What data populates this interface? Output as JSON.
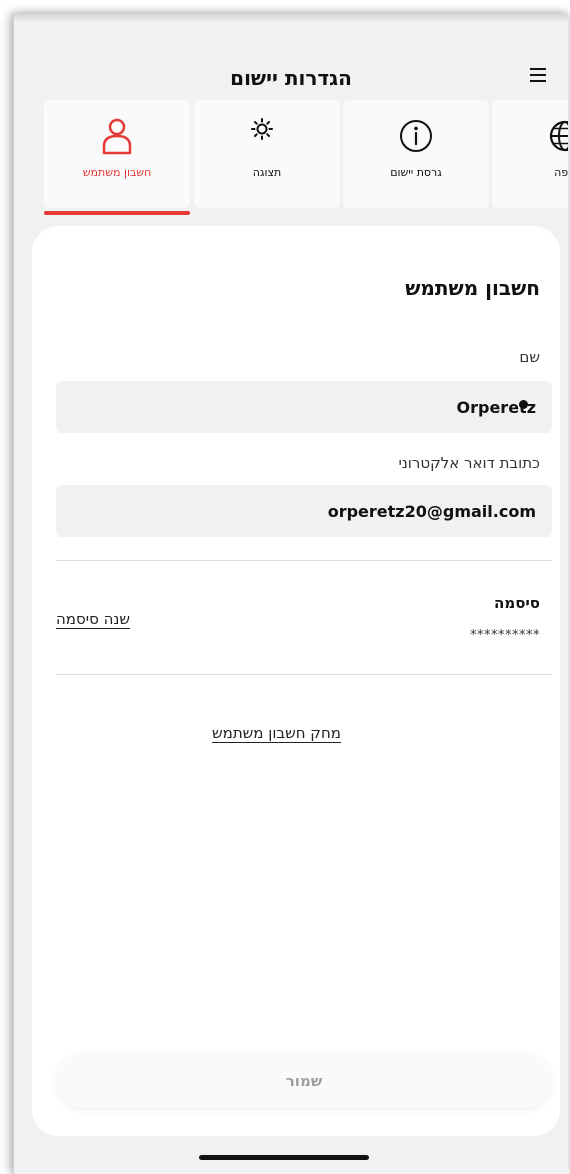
{
  "header": {
    "title": "הגדרות יישום"
  },
  "tabs": [
    {
      "label": "חשבון משתמש",
      "icon": "user-icon",
      "active": true
    },
    {
      "label": "תצוגה",
      "icon": "sun-moon-icon",
      "active": false
    },
    {
      "label": "גרסת יישום",
      "icon": "info-icon",
      "active": false
    },
    {
      "label": "שפה",
      "icon": "globe-icon",
      "active": false
    }
  ],
  "account": {
    "title": "חשבון משתמש",
    "name_label": "שם",
    "name_value": "Orperetz",
    "email_label": "כתובת דואר אלקטרוני",
    "email_value": "orperetz20@gmail.com",
    "password_label": "סיסמה",
    "password_value": "**********",
    "change_password": "שנה סיסמה",
    "delete_account": "מחק חשבון משתמש",
    "save": "שמור"
  },
  "colors": {
    "accent": "#e53935",
    "background": "#f1f1f1",
    "card": "#ffffff"
  }
}
